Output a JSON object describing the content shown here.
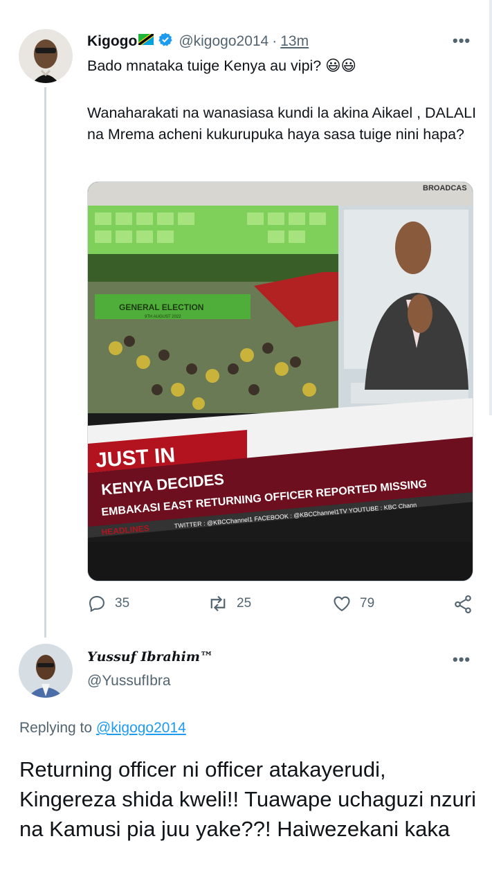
{
  "tweet": {
    "author_name": "Kigogo",
    "author_flag": "🇹🇿",
    "author_handle": "@kigogo2014",
    "separator": "·",
    "time": "13m",
    "line1": "Bado mnataka tuige Kenya au vipi? 😃😃",
    "body": "Wanaharakati na wanasiasa kundi la akina Aikael , DALALI na Mrema acheni kukurupuka haya sasa tuige nini hapa?",
    "media": {
      "corner_label": "BROADCAS",
      "banner_label": "GENERAL ELECTION",
      "banner_date": "9TH AUGUST 2022",
      "just_in": "JUST IN",
      "headline1": "KENYA DECIDES",
      "headline2": "EMBAKASI EAST RETURNING OFFICER REPORTED MISSING",
      "headlines_tag": "HEADLINES",
      "ticker": "TWITTER : @KBCChannel1   FACEBOOK : @KBCChannel1TV   YOUTUBE : KBC Chann"
    },
    "stats": {
      "replies": "35",
      "retweets": "25",
      "likes": "79"
    },
    "more_label": "•••"
  },
  "reply": {
    "author_name": "𝒀𝒖𝒔𝒔𝒖𝒇 𝑰𝒃𝒓𝒂𝒉𝒊𝒎™",
    "author_handle": "@YussufIbra",
    "replying_prefix": "Replying to",
    "replying_to": "@kigogo2014",
    "text": "Returning officer ni officer atakayerudi, Kingereza shida kweli!! Tuawape uchaguzi nzuri na Kamusi pia juu yake??! Haiwezekani kaka",
    "more_label": "•••"
  },
  "colors": {
    "verified": "#1d9bf0",
    "link": "#1d9bf0",
    "secondary": "#536471",
    "news_red": "#b3131f",
    "news_maroon": "#6d0f1e"
  }
}
